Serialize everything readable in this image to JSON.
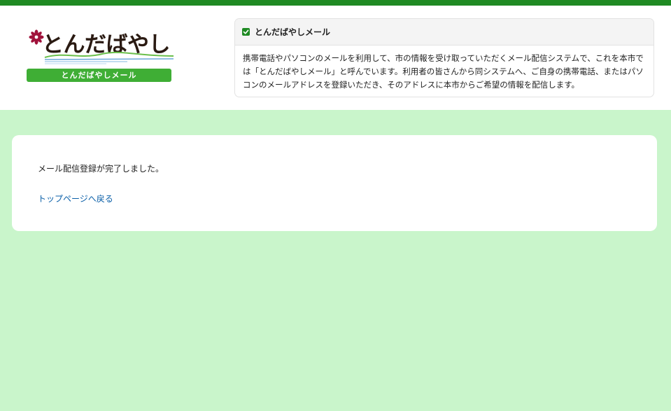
{
  "logo": {
    "title": "とんだばやし",
    "band_label": "とんだばやしメール",
    "icon": "flower-icon"
  },
  "info": {
    "heading": "とんだばやしメール",
    "heading_icon": "check-square-icon",
    "description": "携帯電話やパソコンのメールを利用して、市の情報を受け取っていただくメール配信システムで、これを本市では「とんだばやしメール」と呼んでいます。利用者の皆さんから同システムへ、ご自身の携帯電話、またはパソコンのメールアドレスを登録いただき、そのアドレスに本市からご希望の情報を配信します。"
  },
  "main": {
    "message": "メール配信登録が完了しました。",
    "top_link": "トップページへ戻る"
  },
  "colors": {
    "top_bar": "#1f8a23",
    "background": "#c9f5cb",
    "logo_band": "#3fae35",
    "link": "#0a5fa8"
  }
}
